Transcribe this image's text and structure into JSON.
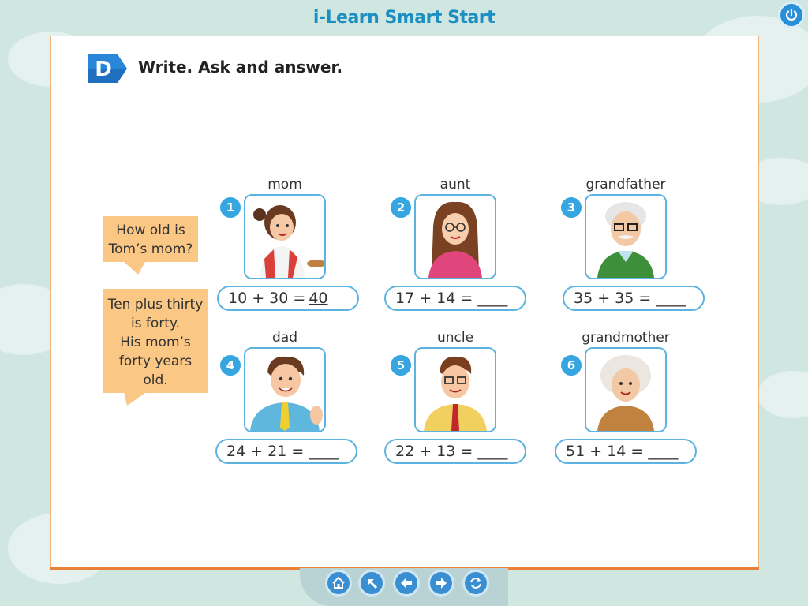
{
  "header": {
    "title": "i-Learn Smart Start"
  },
  "toolbar": {
    "power_icon": "power-icon"
  },
  "exercise": {
    "badge": "D",
    "instruction": "Write. Ask and answer.",
    "question_bubble": [
      "How old is",
      "Tom’s mom?"
    ],
    "answer_bubble": [
      "Ten plus thirty",
      "is forty.",
      "His mom’s",
      "forty years",
      "old."
    ],
    "cards": [
      {
        "number": "1",
        "name": "mom",
        "equation": "10 + 30 =",
        "answer": "40"
      },
      {
        "number": "2",
        "name": "aunt",
        "equation": "17 + 14 = ____",
        "answer": ""
      },
      {
        "number": "3",
        "name": "grandfather",
        "equation": "35 + 35 = ____",
        "answer": ""
      },
      {
        "number": "4",
        "name": "dad",
        "equation": "24 + 21 = ____",
        "answer": ""
      },
      {
        "number": "5",
        "name": "uncle",
        "equation": "22 + 13 = ____",
        "answer": ""
      },
      {
        "number": "6",
        "name": "grandmother",
        "equation": "51 + 14 = ____",
        "answer": ""
      }
    ]
  },
  "navigation": {
    "buttons": [
      "home-icon",
      "up-left-arrow-icon",
      "back-arrow-icon",
      "forward-arrow-icon",
      "refresh-icon"
    ]
  },
  "colors": {
    "accent": "#36a6e1",
    "bubble": "#fbc785",
    "page_border": "#e9803a",
    "title": "#1b8fc2"
  }
}
